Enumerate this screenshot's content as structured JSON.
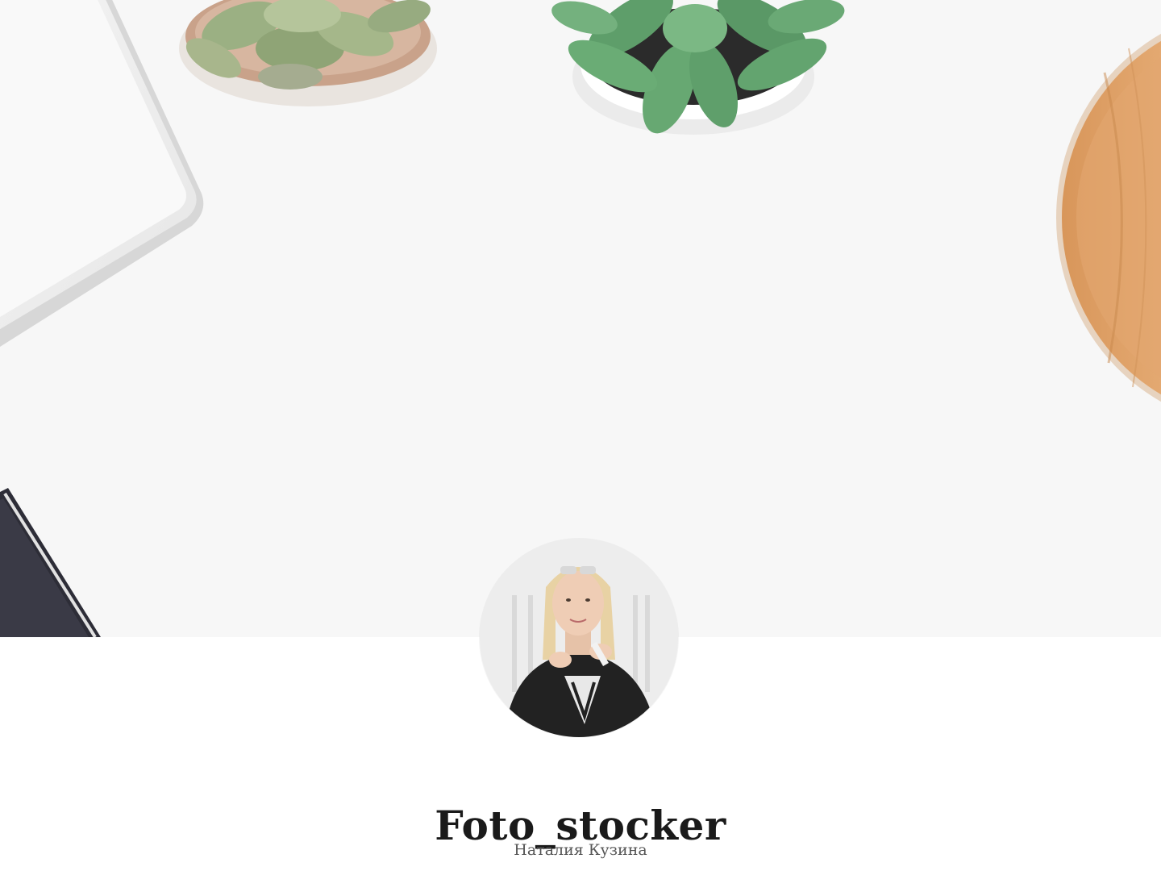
{
  "profile": {
    "username": "Foto_stocker",
    "full_name": "Наталия Кузина"
  },
  "colors": {
    "background": "#ffffff",
    "cover_background": "#f7f7f7",
    "title_text": "#1a1a1a",
    "subtitle_text": "#555555"
  }
}
